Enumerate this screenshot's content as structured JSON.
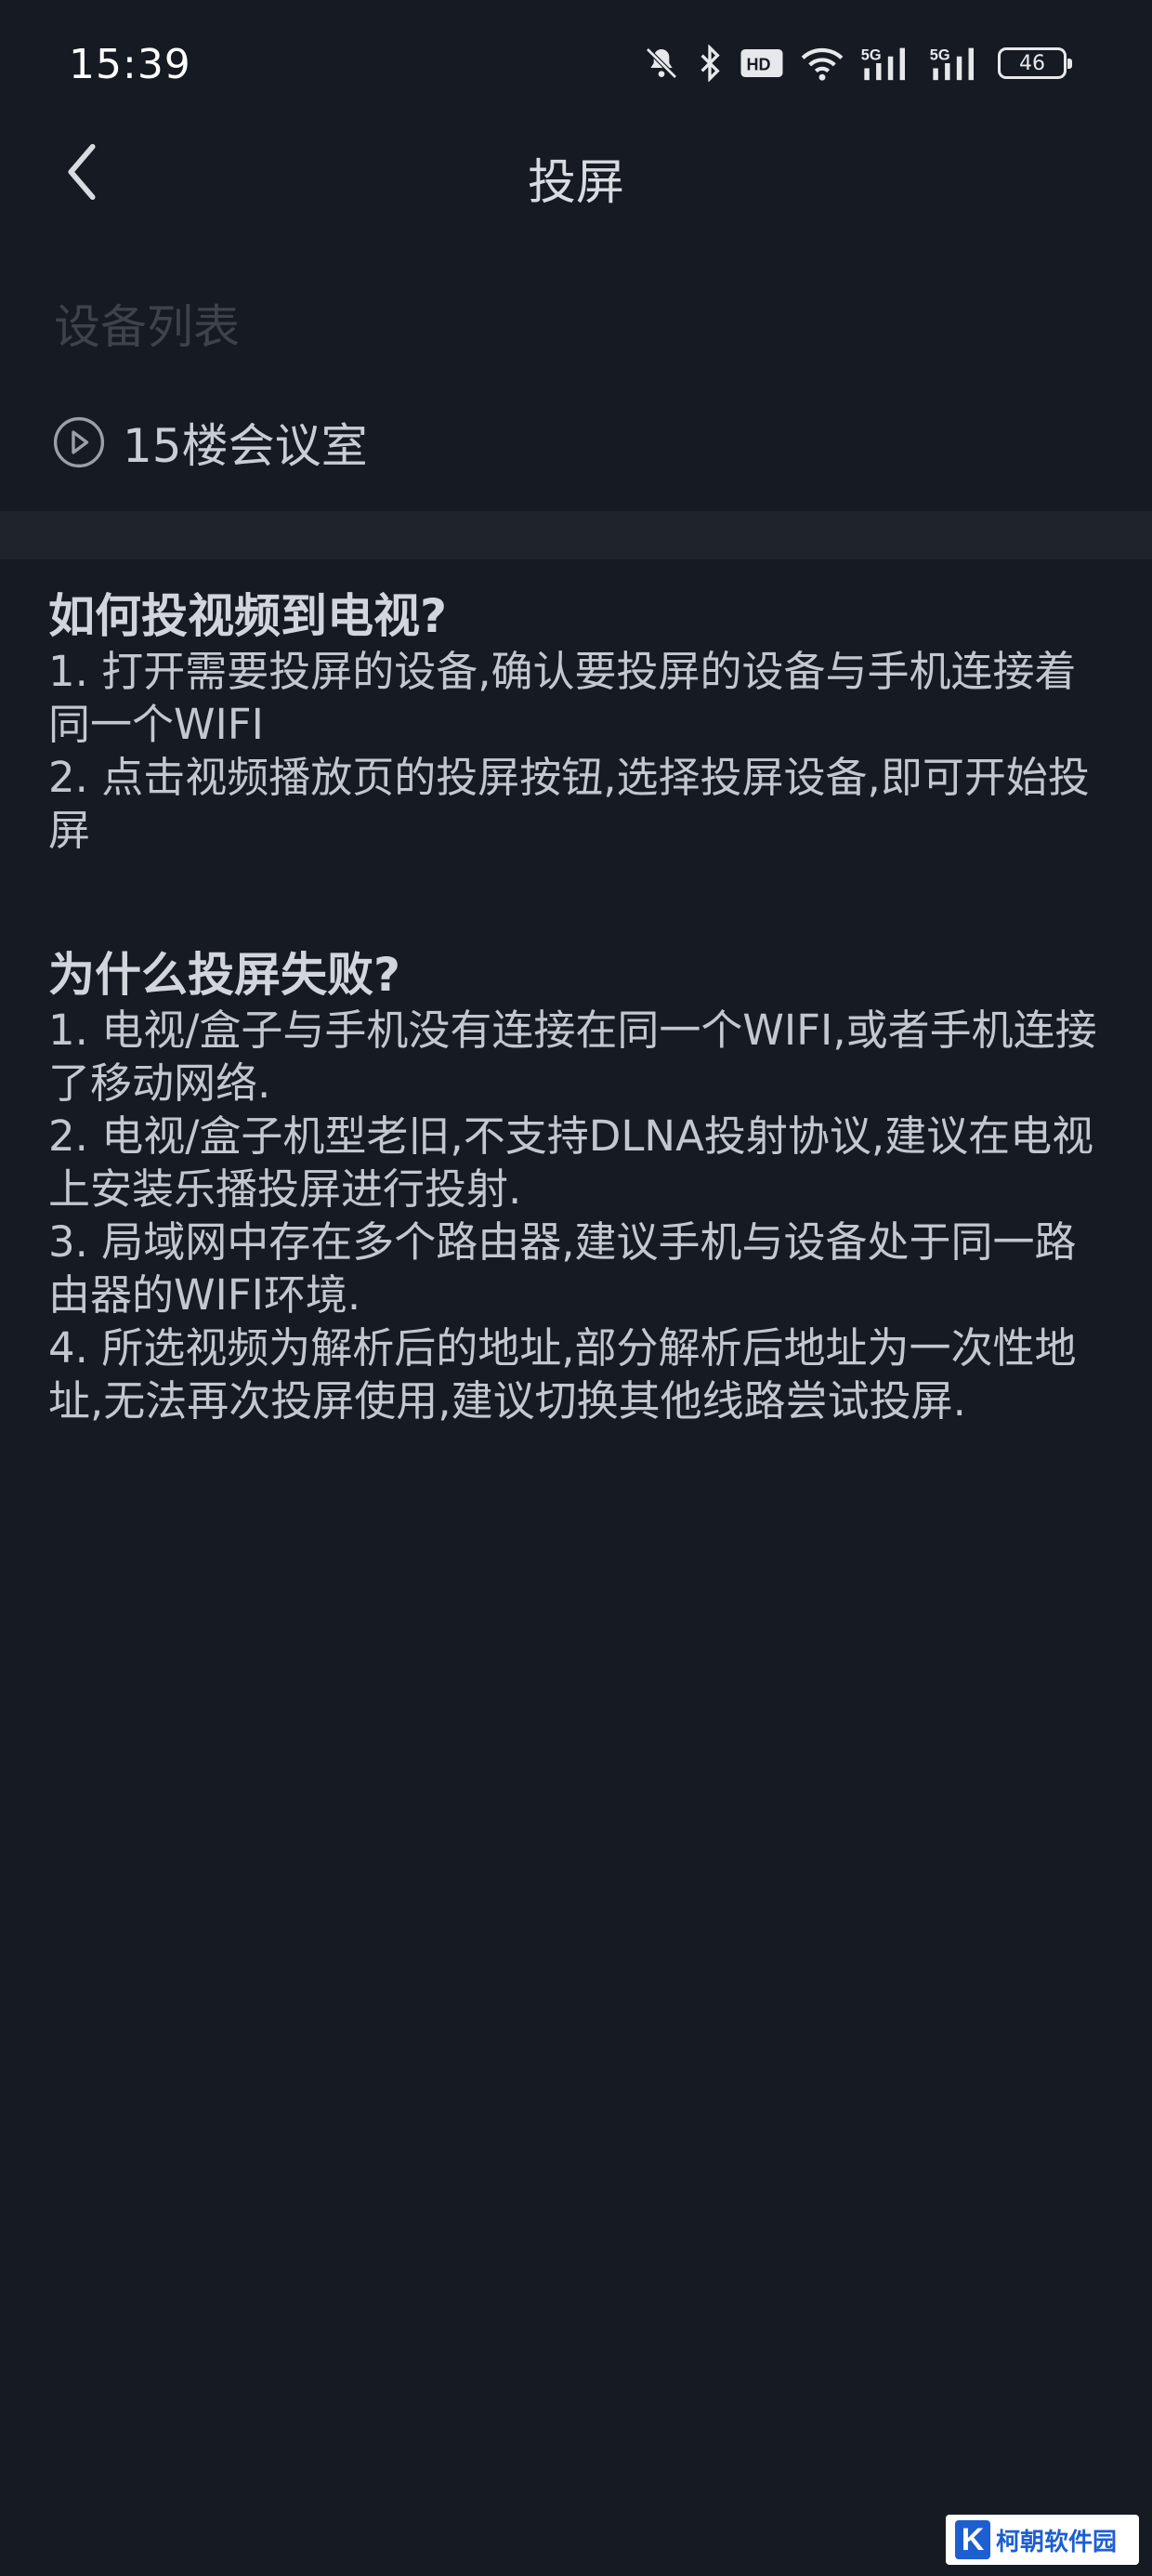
{
  "status_bar": {
    "time": "15:39",
    "icons": [
      "bell-muted-icon",
      "bluetooth-icon",
      "hd-icon",
      "wifi-icon",
      "signal-5g-icon",
      "signal-5g-icon"
    ],
    "hd_label": "HD",
    "sim1_label": "5G",
    "sim2_label": "5G",
    "battery": "46"
  },
  "header": {
    "title": "投屏",
    "back_icon": "chevron-left-icon"
  },
  "devices": {
    "section_label": "设备列表",
    "items": [
      {
        "name": "15楼会议室",
        "icon": "play-circle-icon"
      }
    ]
  },
  "help": {
    "sections": [
      {
        "title": "如何投视频到电视?",
        "items": [
          "1. 打开需要投屏的设备,确认要投屏的设备与手机连接着同一个WIFI",
          "2. 点击视频播放页的投屏按钮,选择投屏设备,即可开始投屏"
        ]
      },
      {
        "title": "为什么投屏失败?",
        "items": [
          "1. 电视/盒子与手机没有连接在同一个WIFI,或者手机连接了移动网络.",
          "2. 电视/盒子机型老旧,不支持DLNA投射协议,建议在电视上安装乐播投屏进行投射.",
          "3. 局域网中存在多个路由器,建议手机与设备处于同一路由器的WIFI环境.",
          "4. 所选视频为解析后的地址,部分解析后地址为一次性地址,无法再次投屏使用,建议切换其他线路尝试投屏."
        ]
      }
    ]
  },
  "watermark": {
    "logo_letter": "K",
    "text": "柯朝软件园"
  },
  "colors": {
    "background": "#161a22",
    "band": "#1e232c",
    "text": "#c3c7ce"
  }
}
